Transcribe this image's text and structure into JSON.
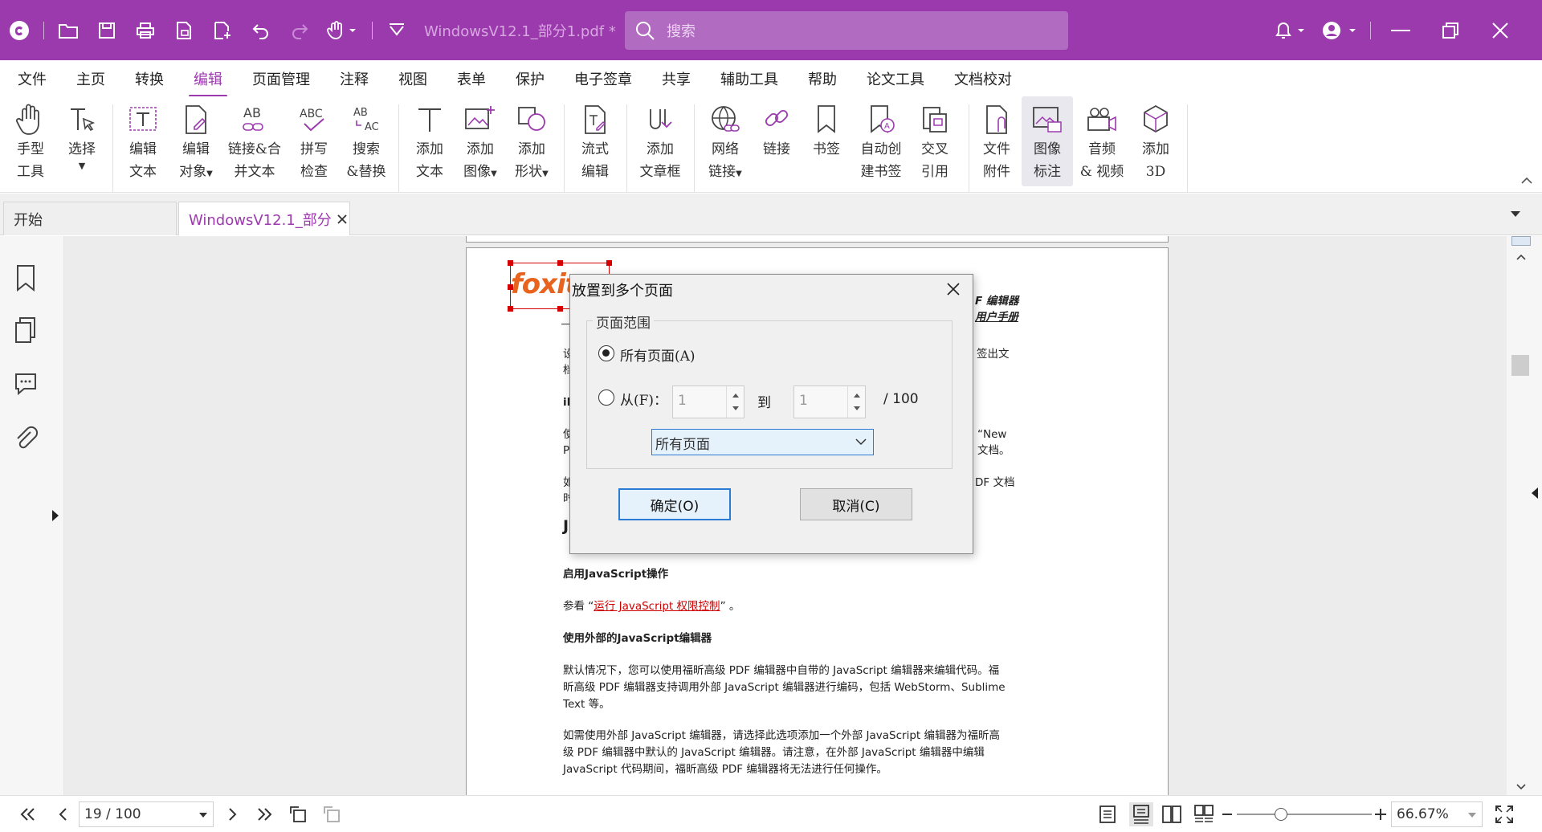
{
  "titlebar": {
    "doc_title": "WindowsV12.1_部分1.pdf * -...",
    "search_placeholder": "搜索"
  },
  "menu": {
    "items": [
      "文件",
      "主页",
      "转换",
      "编辑",
      "页面管理",
      "注释",
      "视图",
      "表单",
      "保护",
      "电子签章",
      "共享",
      "辅助工具",
      "帮助",
      "论文工具",
      "文档校对"
    ],
    "active": "编辑"
  },
  "ribbon": {
    "hand": [
      "手型",
      "工具"
    ],
    "select": [
      "选择"
    ],
    "edit_text": [
      "编辑",
      "文本"
    ],
    "edit_object": [
      "编辑",
      "对象"
    ],
    "link_merge": [
      "链接&合",
      "并文本"
    ],
    "spell": [
      "拼写",
      "检查"
    ],
    "search_replace": [
      "搜索",
      "&替换"
    ],
    "add_text": [
      "添加",
      "文本"
    ],
    "add_image": [
      "添加",
      "图像"
    ],
    "add_shape": [
      "添加",
      "形状"
    ],
    "flow_edit": [
      "流式",
      "编辑"
    ],
    "add_article": [
      "添加",
      "文章框"
    ],
    "web_link": [
      "网络",
      "链接"
    ],
    "link": [
      "链接"
    ],
    "bookmark": [
      "书签"
    ],
    "auto_bookmark": [
      "自动创",
      "建书签"
    ],
    "cross_ref": [
      "交叉",
      "引用"
    ],
    "file_attach": [
      "文件",
      "附件"
    ],
    "image_annot": [
      "图像",
      "标注"
    ],
    "audio_video": [
      "音频",
      "& 视频"
    ],
    "add_3d": [
      "添加",
      "3D"
    ]
  },
  "tabs": {
    "home": "开始",
    "doc": "WindowsV12.1_部分..."
  },
  "page": {
    "logo": "foxit",
    "header_right_1": "F 编辑器",
    "header_right_2": "用户手册",
    "lines": [
      {
        "t": "设",
        "b": false
      },
      {
        "t": "档",
        "b": false
      }
    ],
    "right_frag_1": "签出文",
    "bold_frag": "iM",
    "new_frag": "“New",
    "p_frag": "P",
    "doc_frag": "文档。",
    "use_frag": "使",
    "if_frag": "如",
    "pdf_doc_frag": "DF 文档",
    "time_frag": "时",
    "heading_frag": "Ja",
    "enable_js": "启用JavaScript操作",
    "see_prefix": "参看 “",
    "see_link": "运行 JavaScript 权限控制",
    "see_suffix": "” 。",
    "external_heading": "使用外部的JavaScript编辑器",
    "para1": [
      "默认情况下，您可以使用福昕高级 PDF 编辑器中自带的 JavaScript 编辑器来编辑代码。福",
      "昕高级 PDF 编辑器支持调用外部 JavaScript 编辑器进行编码，包括 WebStorm、Sublime",
      "Text 等。"
    ],
    "para2": [
      "如需使用外部 JavaScript 编辑器，请选择此选项添加一个外部 JavaScript 编辑器为福昕高",
      "级 PDF 编辑器中默认的 JavaScript 编辑器。请注意，在外部 JavaScript 编辑器中编辑",
      "JavaScript 代码期间，福昕高级 PDF 编辑器将无法进行任何操作。"
    ]
  },
  "dialog": {
    "title": "放置到多个页面",
    "group_title": "页面范围",
    "all_pages_radio": "所有页面(A)",
    "from_radio": "从(F)：",
    "from_value": "1",
    "to_label": "到",
    "to_value": "1",
    "total": "/ 100",
    "select_value": "所有页面",
    "ok": "确定(O)",
    "cancel": "取消(C)"
  },
  "statusbar": {
    "page_value": "19 / 100",
    "zoom": "66.67%",
    "zoom_level": 0.33
  }
}
